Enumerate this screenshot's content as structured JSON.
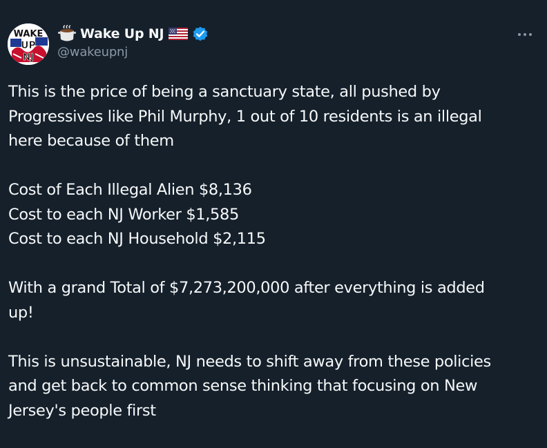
{
  "author": {
    "display_name": "Wake Up NJ",
    "handle": "@wakeupnj",
    "avatar_text": [
      "WAKE",
      "UP",
      "NJ"
    ],
    "name_emoji_left": "pot-emoji-icon",
    "name_emoji_right": "us-flag-icon",
    "verified_icon": "verified-badge-icon"
  },
  "menu": {
    "icon": "more-options-icon"
  },
  "post": {
    "p1": [
      "This is the price of being a sanctuary state, all pushed by",
      "Progressives like Phil Murphy, 1 out of 10 residents is an illegal",
      "here because of them"
    ],
    "p2": [
      "Cost of Each Illegal Alien $8,136",
      "Cost to each NJ Worker $1,585",
      "Cost to each NJ Household $2,115"
    ],
    "p3": [
      "With a grand Total of $7,273,200,000 after everything is added",
      "up!"
    ],
    "p4": [
      "This is unsustainable, NJ needs to shift away from these policies",
      "and get back to common sense thinking that focusing on New",
      "Jersey's people first"
    ]
  },
  "colors": {
    "background": "#15202b",
    "text": "#f7f9f9",
    "secondary_text": "#8b98a5",
    "verified_blue": "#1d9bf0"
  }
}
